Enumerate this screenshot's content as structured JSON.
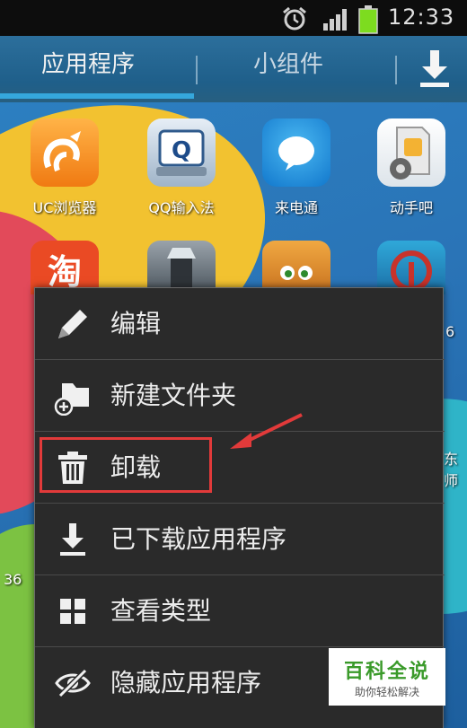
{
  "status_bar": {
    "time": "12:33",
    "icons": [
      "alarm-icon",
      "signal-icon",
      "battery-icon"
    ],
    "battery_color": "#7ddc1f"
  },
  "tabs": [
    {
      "label": "应用程序",
      "selected": true
    },
    {
      "label": "小组件",
      "selected": false
    }
  ],
  "tab_accent": "#35a7dc",
  "apps_row1": [
    {
      "label": "UC浏览器",
      "icon": "uc-browser-icon"
    },
    {
      "label": "QQ输入法",
      "icon": "qq-input-icon"
    },
    {
      "label": "来电通",
      "icon": "call-icon"
    },
    {
      "label": "动手吧",
      "icon": "sim-gear-icon"
    }
  ],
  "apps_row2_icons": [
    "taobao-icon",
    "flashlight-icon",
    "talking-cat-icon",
    "railway-icon"
  ],
  "partial_labels": {
    "right_row2": "6",
    "right_row3": "东师",
    "left_row4": "36"
  },
  "context_menu": {
    "items": [
      {
        "label": "编辑",
        "icon": "pencil-icon"
      },
      {
        "label": "新建文件夹",
        "icon": "new-folder-icon"
      },
      {
        "label": "卸载",
        "icon": "trash-icon",
        "highlighted": true
      },
      {
        "label": "已下载应用程序",
        "icon": "download-icon"
      },
      {
        "label": "查看类型",
        "icon": "grid-icon"
      },
      {
        "label": "隐藏应用程序",
        "icon": "eye-hidden-icon"
      }
    ]
  },
  "annotation_color": "#e23a3a",
  "watermark": {
    "title": "百科全说",
    "subtitle": "助你轻松解决"
  }
}
